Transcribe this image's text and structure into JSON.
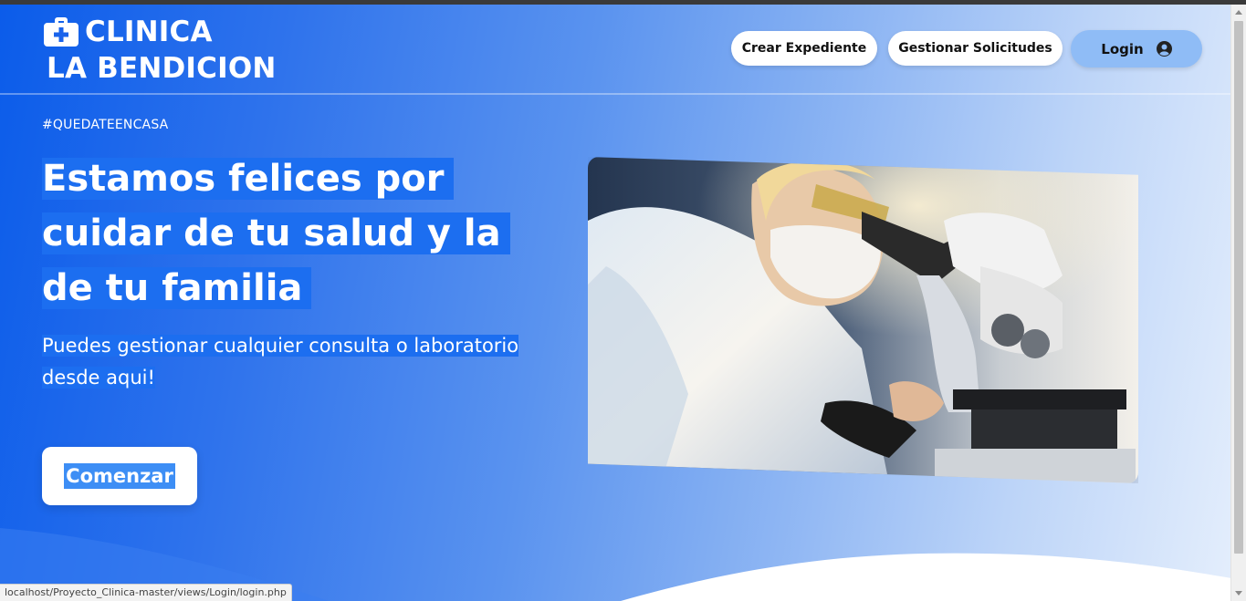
{
  "brand": {
    "line1": "CLINICA",
    "line2": "LA BENDICION",
    "icon": "medical-kit-icon"
  },
  "nav": {
    "crear_expediente": "Crear Expediente",
    "gestionar_solicitudes": "Gestionar Solicitudes",
    "login": "Login",
    "login_icon": "user-circle-icon"
  },
  "hero": {
    "hashtag": "#QUEDATEENCASA",
    "headline": "Estamos felices por cuidar de tu salud y la de tu familia",
    "subtitle": "Puedes gestionar cualquier consulta o laboratorio desde aqui!",
    "cta": "Comenzar",
    "image": "scientist-with-microscope-photo"
  },
  "statusbar": {
    "url": "localhost/Proyecto_Clinica-master/views/Login/login.php"
  },
  "colors": {
    "gradient_start": "#0b5cea",
    "gradient_end": "#e4eefc",
    "text_highlight": "#1c6ef0",
    "login_button": "#8fbcf6"
  }
}
